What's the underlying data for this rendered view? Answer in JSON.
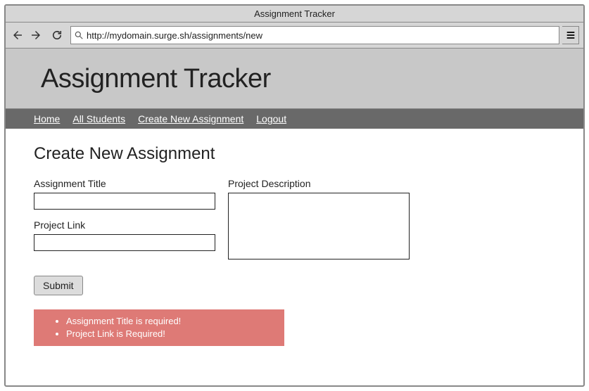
{
  "window": {
    "title": "Assignment Tracker"
  },
  "toolbar": {
    "url": "http://mydomain.surge.sh/assignments/new"
  },
  "header": {
    "title": "Assignment Tracker"
  },
  "nav": {
    "home": "Home",
    "all_students": "All Students",
    "create_new": "Create New Assignment",
    "logout": "Logout"
  },
  "page": {
    "heading": "Create New Assignment",
    "fields": {
      "title_label": "Assignment Title",
      "title_value": "",
      "link_label": "Project Link",
      "link_value": "",
      "description_label": "Project Description",
      "description_value": ""
    },
    "submit_label": "Submit",
    "errors": {
      "items": [
        "Assignment Title is required!",
        "Project Link is Required!"
      ]
    }
  }
}
